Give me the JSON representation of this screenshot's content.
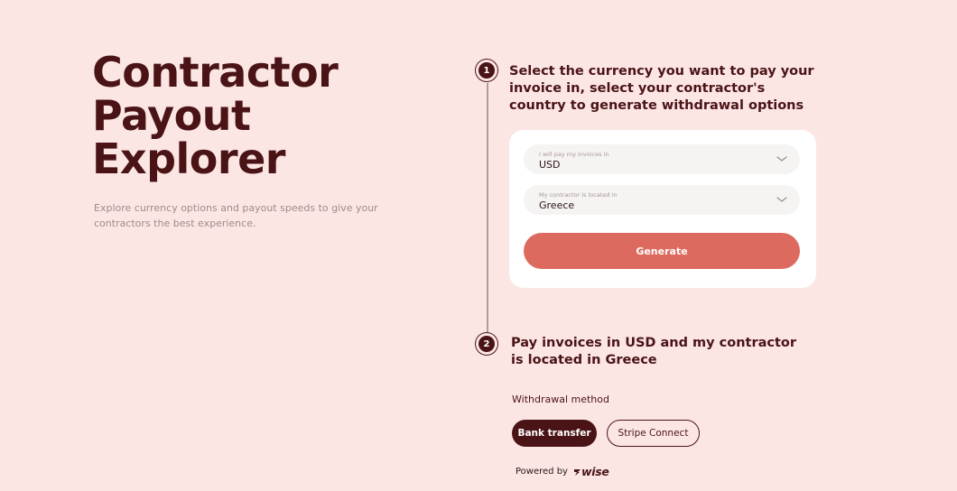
{
  "hero": {
    "title_lines": [
      "Contractor",
      "Payout",
      "Explorer"
    ],
    "subtitle": "Explore currency options and payout speeds to give your contractors the best experience."
  },
  "step1": {
    "number": "1",
    "title": "Select the currency you want to pay your invoice in, select your contractor's country to generate withdrawal options",
    "currency_select": {
      "label": "I will pay my invoices in",
      "value": "USD"
    },
    "country_select": {
      "label": "My contractor is located in",
      "value": "Greece"
    },
    "generate_label": "Generate"
  },
  "step2": {
    "number": "2",
    "title": "Pay invoices in USD and my contractor is located in Greece",
    "withdrawal_label": "Withdrawal method",
    "methods": [
      "Bank transfer",
      "Stripe Connect"
    ],
    "selected_method": "Bank transfer"
  },
  "footer": {
    "powered_by": "Powered by",
    "brand": "wise"
  },
  "colors": {
    "background": "#fce6e4",
    "primary_dark": "#4a1416",
    "accent": "#dd6a5f"
  }
}
